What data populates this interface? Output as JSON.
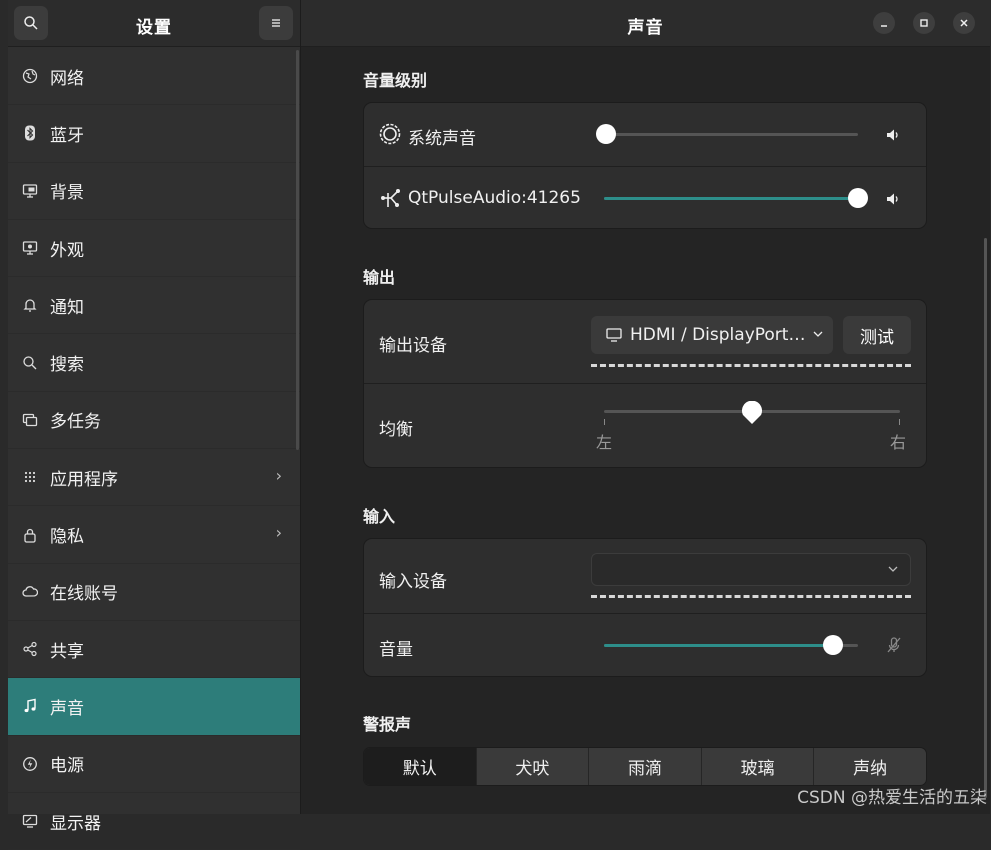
{
  "sidebar": {
    "title": "设置",
    "items": [
      {
        "label": "网络",
        "icon": "globe-icon"
      },
      {
        "label": "蓝牙",
        "icon": "bluetooth-icon"
      },
      {
        "label": "背景",
        "icon": "monitor-icon"
      },
      {
        "label": "外观",
        "icon": "appearance-icon"
      },
      {
        "label": "通知",
        "icon": "bell-icon"
      },
      {
        "label": "搜索",
        "icon": "search-icon"
      },
      {
        "label": "多任务",
        "icon": "multitask-icon"
      },
      {
        "label": "应用程序",
        "icon": "grid-icon",
        "chevron": "›"
      },
      {
        "label": "隐私",
        "icon": "lock-icon",
        "chevron": "›"
      },
      {
        "label": "在线账号",
        "icon": "cloud-icon"
      },
      {
        "label": "共享",
        "icon": "share-icon"
      },
      {
        "label": "声音",
        "icon": "music-note-icon",
        "active": true
      },
      {
        "label": "电源",
        "icon": "power-icon"
      },
      {
        "label": "显示器",
        "icon": "display-icon"
      }
    ]
  },
  "main": {
    "title": "声音",
    "volume_levels": {
      "title": "音量级别",
      "rows": [
        {
          "label": "系统声音",
          "level": 0.0
        },
        {
          "label": "QtPulseAudio:41265",
          "level": 1.0
        }
      ]
    },
    "output": {
      "title": "输出",
      "device_label": "输出设备",
      "device_value": "HDMI / DisplayPort…",
      "test_button": "测试",
      "balance_label": "均衡",
      "balance_value": 0.5,
      "balance_left": "左",
      "balance_right": "右"
    },
    "input": {
      "title": "输入",
      "device_label": "输入设备",
      "device_value": "",
      "volume_label": "音量",
      "volume_level": 0.9
    },
    "alert": {
      "title": "警报声",
      "options": [
        "默认",
        "犬吠",
        "雨滴",
        "玻璃",
        "声纳"
      ],
      "selected": "默认"
    }
  },
  "watermark": "CSDN @热爱生活的五柒",
  "colors": {
    "accent": "#2d8e8a",
    "active_sidebar": "#2d7d7a"
  }
}
